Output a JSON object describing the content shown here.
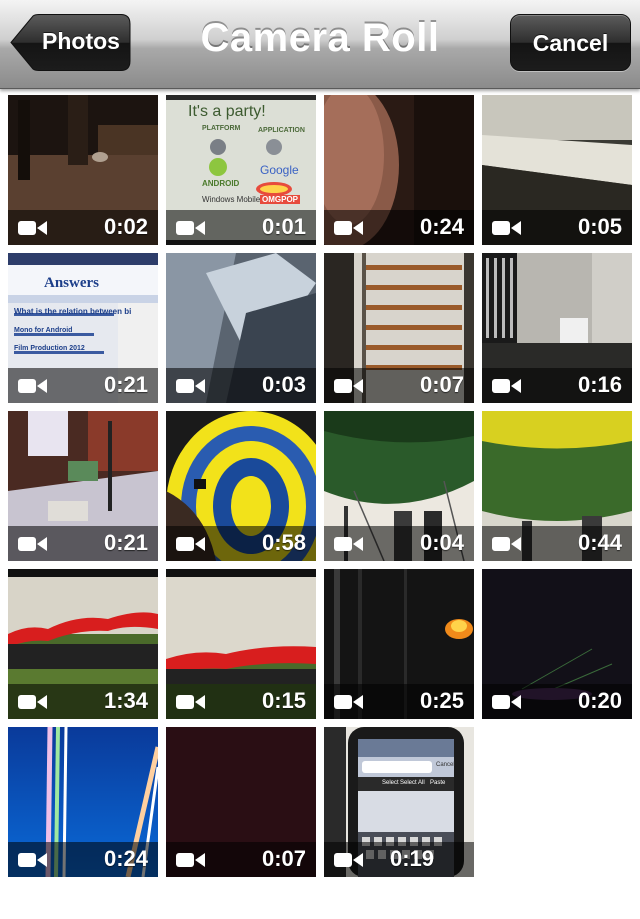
{
  "navbar": {
    "title": "Camera Roll",
    "back_label": "Photos",
    "cancel_label": "Cancel"
  },
  "colors": {
    "navbar_top": "#f4f4f4",
    "navbar_bottom": "#8b8b8b",
    "button_dark": "#1c1c1c",
    "text_white": "#ffffff"
  },
  "videos": [
    {
      "duration": "0:02",
      "icon": "video-camera-icon"
    },
    {
      "duration": "0:01",
      "icon": "video-camera-icon",
      "overlay": {
        "heading": "It's a party!",
        "col1": "PLATFORM",
        "col2": "APPLICATION",
        "brand1": "ANDROID",
        "brand2": "Google",
        "brand3": "Windows Mobile",
        "brand4": "OMGPOP"
      }
    },
    {
      "duration": "0:24",
      "icon": "video-camera-icon"
    },
    {
      "duration": "0:05",
      "icon": "video-camera-icon"
    },
    {
      "duration": "0:21",
      "icon": "video-camera-icon",
      "overlay": {
        "heading": "Answers",
        "line1": "What is the relation between bi",
        "line2": "Mono for Android",
        "line3": "Film Production 2012"
      }
    },
    {
      "duration": "0:03",
      "icon": "video-camera-icon"
    },
    {
      "duration": "0:07",
      "icon": "video-camera-icon"
    },
    {
      "duration": "0:16",
      "icon": "video-camera-icon"
    },
    {
      "duration": "0:21",
      "icon": "video-camera-icon"
    },
    {
      "duration": "0:58",
      "icon": "video-camera-icon"
    },
    {
      "duration": "0:04",
      "icon": "video-camera-icon"
    },
    {
      "duration": "0:44",
      "icon": "video-camera-icon"
    },
    {
      "duration": "1:34",
      "icon": "video-camera-icon"
    },
    {
      "duration": "0:15",
      "icon": "video-camera-icon"
    },
    {
      "duration": "0:25",
      "icon": "video-camera-icon"
    },
    {
      "duration": "0:20",
      "icon": "video-camera-icon"
    },
    {
      "duration": "0:24",
      "icon": "video-camera-icon"
    },
    {
      "duration": "0:07",
      "icon": "video-camera-icon"
    },
    {
      "duration": "0:19",
      "icon": "video-camera-icon",
      "overlay": {
        "line1": "Select",
        "line2": "Select All",
        "line3": "Paste",
        "line4": "Cancel"
      }
    }
  ]
}
